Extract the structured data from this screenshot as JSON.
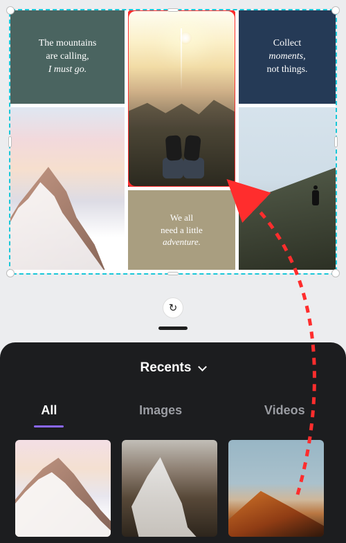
{
  "colors": {
    "selection": "#18c7d8",
    "highlight": "#ff2d2d",
    "accent": "#8b68ff"
  },
  "collage": {
    "cell1": {
      "line1": "The mountains",
      "line2": "are calling,",
      "line3": "I must go."
    },
    "cell3": {
      "line1": "Collect",
      "line2": "moments,",
      "line3": "not things."
    },
    "cell5": {
      "line1": "We all",
      "line2": "need a little",
      "line3": "adventure."
    }
  },
  "refresh_icon": "↻",
  "panel": {
    "title": "Recents",
    "tabs": [
      {
        "label": "All",
        "active": true
      },
      {
        "label": "Images",
        "active": false
      },
      {
        "label": "Videos",
        "active": false
      }
    ]
  }
}
